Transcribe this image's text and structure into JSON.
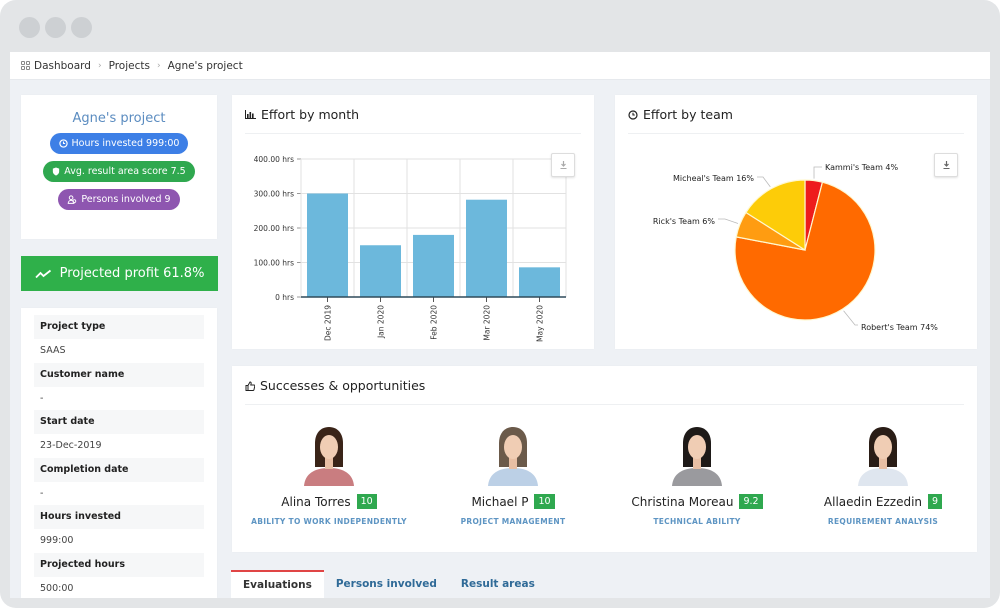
{
  "window": {
    "traffic_lights": [
      "window-dot",
      "window-dot",
      "window-dot"
    ]
  },
  "breadcrumb": {
    "icon": "dashboard-grid-icon",
    "items": [
      "Dashboard",
      "Projects",
      "Agne's project"
    ],
    "separator": "›"
  },
  "project": {
    "title": "Agne's project",
    "pills": [
      {
        "icon": "clock-icon",
        "label": "Hours invested 999:00",
        "color": "#3d7fe6"
      },
      {
        "icon": "shield-icon",
        "label": "Avg. result area score 7.5",
        "color": "#2fa84f"
      },
      {
        "icon": "persons-icon",
        "label": "Persons involved 9",
        "color": "#8e56b0"
      }
    ],
    "profit": {
      "icon": "trend-line-icon",
      "label": "Projected profit 61.8%",
      "color": "#2fb04a"
    }
  },
  "details": [
    {
      "label": "Project type",
      "value": "SAAS"
    },
    {
      "label": "Customer name",
      "value": "-"
    },
    {
      "label": "Start date",
      "value": "23-Dec-2019"
    },
    {
      "label": "Completion date",
      "value": "-"
    },
    {
      "label": "Hours invested",
      "value": "999:00"
    },
    {
      "label": "Projected hours",
      "value": "500:00"
    }
  ],
  "effort_month": {
    "title": "Effort by month",
    "icon": "bar-chart-icon",
    "download_icon": "download-icon"
  },
  "effort_team": {
    "title": "Effort by team",
    "icon": "pie-clock-icon",
    "download_icon": "download-icon"
  },
  "chart_data": [
    {
      "type": "bar",
      "title": "Effort by month",
      "categories": [
        "Dec 2019",
        "Jan 2020",
        "Feb 2020",
        "Mar 2020",
        "May 2020"
      ],
      "values": [
        300,
        150,
        180,
        282,
        86
      ],
      "ylim": [
        0,
        400
      ],
      "yticks": [
        0,
        100,
        200,
        300,
        400
      ],
      "ytick_labels": [
        "0 hrs",
        "100.00 hrs",
        "200.00 hrs",
        "300.00 hrs",
        "400.00 hrs"
      ],
      "xlabel": "",
      "ylabel": "",
      "grid": true,
      "bar_color": "#6cb8dc"
    },
    {
      "type": "pie",
      "title": "Effort by team",
      "slices": [
        {
          "label": "Kammi's Team",
          "value": 4,
          "color": "#ee1c1c"
        },
        {
          "label": "Robert's Team",
          "value": 74,
          "color": "#ff6a00"
        },
        {
          "label": "Rick's Team",
          "value": 6,
          "color": "#ff9c11"
        },
        {
          "label": "Micheal's Team",
          "value": 16,
          "color": "#fdcc08"
        }
      ],
      "label_format": "{label} {value}%"
    }
  ],
  "successes": {
    "title": "Successes & opportunities",
    "icon": "thumbs-up-icon",
    "people": [
      {
        "name": "Alina Torres",
        "score": "10",
        "skill": "ABILITY TO WORK INDEPENDENTLY",
        "shirt": "#c97d80",
        "hair": "#3a2418"
      },
      {
        "name": "Michael P",
        "score": "10",
        "skill": "PROJECT MANAGEMENT",
        "shirt": "#bcd0e6",
        "hair": "#6b5a4a"
      },
      {
        "name": "Christina Moreau",
        "score": "9.2",
        "skill": "TECHNICAL ABILITY",
        "shirt": "#9a9a9e",
        "hair": "#1e1a18"
      },
      {
        "name": "Allaedin Ezzedin",
        "score": "9",
        "skill": "REQUIREMENT ANALYSIS",
        "shirt": "#dfe6ef",
        "hair": "#2a1d16"
      }
    ]
  },
  "tabs": [
    {
      "label": "Evaluations",
      "active": true
    },
    {
      "label": "Persons involved",
      "active": false
    },
    {
      "label": "Result areas",
      "active": false
    }
  ]
}
